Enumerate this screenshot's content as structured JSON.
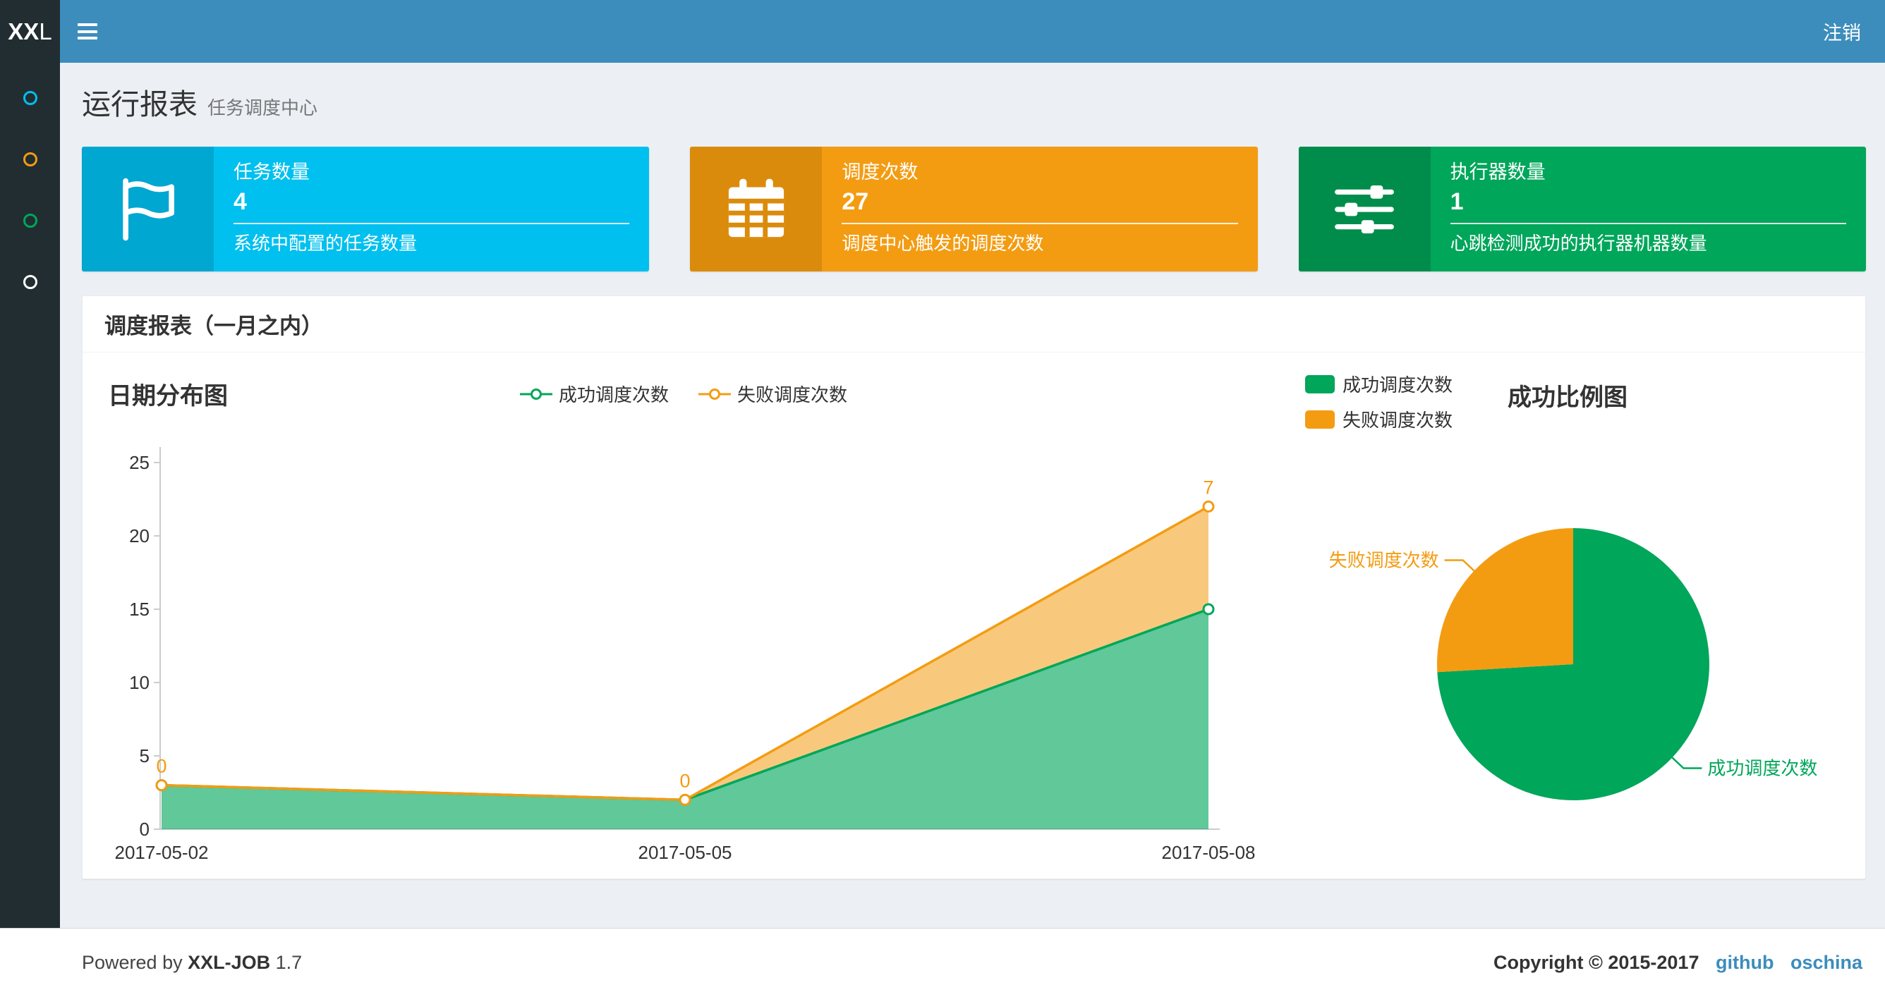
{
  "navbar": {
    "logo_bold": "XX",
    "logo_light": "L",
    "logout_label": "注销"
  },
  "sidebar": {
    "items": [
      {
        "name": "sidebar-item-1",
        "icon": "circle-icon",
        "color": "#00c0ef"
      },
      {
        "name": "sidebar-item-2",
        "icon": "circle-icon",
        "color": "#f39c12"
      },
      {
        "name": "sidebar-item-3",
        "icon": "circle-icon",
        "color": "#00a65a"
      },
      {
        "name": "sidebar-item-4",
        "icon": "circle-icon",
        "color": "#ffffff"
      }
    ]
  },
  "page": {
    "title": "运行报表",
    "subtitle": "任务调度中心"
  },
  "info_boxes": [
    {
      "title": "任务数量",
      "value": "4",
      "description": "系统中配置的任务数量",
      "color": "#00c0ef",
      "icon_bg": "#00a7d0",
      "icon": "flag-icon"
    },
    {
      "title": "调度次数",
      "value": "27",
      "description": "调度中心触发的调度次数",
      "color": "#f39c12",
      "icon_bg": "#db8b0b",
      "icon": "calendar-icon"
    },
    {
      "title": "执行器数量",
      "value": "1",
      "description": "心跳检测成功的执行器机器数量",
      "color": "#00a65a",
      "icon_bg": "#008d4c",
      "icon": "sliders-icon"
    }
  ],
  "panel": {
    "title": "调度报表（一月之内）"
  },
  "chart_data": [
    {
      "type": "area",
      "title": "日期分布图",
      "stacked": true,
      "x": [
        "2017-05-02",
        "2017-05-05",
        "2017-05-08"
      ],
      "series": [
        {
          "name": "成功调度次数",
          "values": [
            3,
            2,
            15
          ],
          "color": "#00a65a"
        },
        {
          "name": "失败调度次数",
          "values": [
            0,
            0,
            7
          ],
          "color": "#f39c12"
        }
      ],
      "point_labels": [
        "0",
        "0",
        "7"
      ],
      "ylim": [
        0,
        25
      ],
      "yticks": [
        0,
        5,
        10,
        15,
        20,
        25
      ],
      "legend_position": "top-center",
      "grid": false
    },
    {
      "type": "pie",
      "title": "成功比例图",
      "slices": [
        {
          "name": "成功调度次数",
          "value": 20,
          "color": "#00a65a"
        },
        {
          "name": "失败调度次数",
          "value": 7,
          "color": "#f39c12"
        }
      ],
      "legend_position": "top-left"
    }
  ],
  "footer": {
    "powered_prefix": "Powered by",
    "brand": "XXL-JOB",
    "version": "1.7",
    "copyright": "Copyright © 2015-2017",
    "links": [
      "github",
      "oschina"
    ]
  }
}
